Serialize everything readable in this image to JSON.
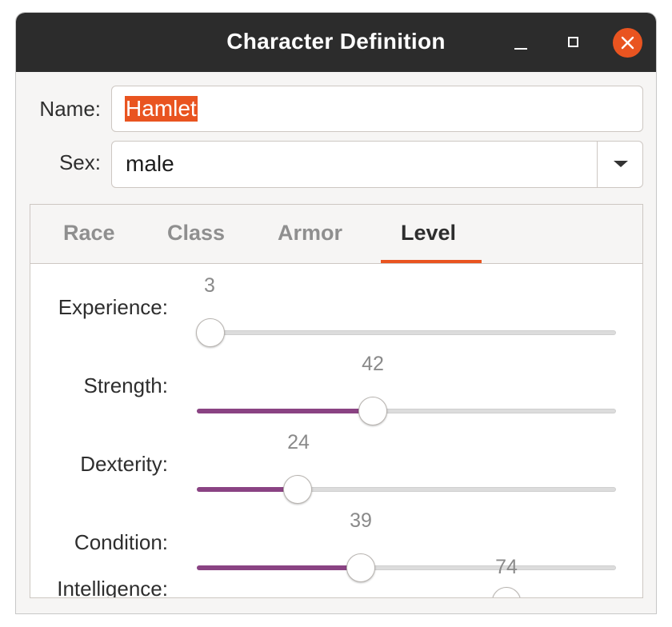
{
  "window": {
    "title": "Character Definition"
  },
  "form": {
    "name_label": "Name:",
    "name_value": "Hamlet",
    "sex_label": "Sex:",
    "sex_value": "male"
  },
  "tabs": [
    {
      "label": "Race",
      "active": false
    },
    {
      "label": "Class",
      "active": false
    },
    {
      "label": "Armor",
      "active": false
    },
    {
      "label": "Level",
      "active": true
    }
  ],
  "sliders": [
    {
      "label": "Experience:",
      "value": "3"
    },
    {
      "label": "Strength:",
      "value": "42"
    },
    {
      "label": "Dexterity:",
      "value": "24"
    },
    {
      "label": "Condition:",
      "value": "39"
    },
    {
      "label": "Intelligence:",
      "value": "74"
    }
  ],
  "colors": {
    "accent": "#e95420",
    "slider_fill": "#8a4383",
    "titlebar": "#2c2c2c"
  },
  "icons": {
    "minimize": "minimize-icon",
    "maximize": "maximize-icon",
    "close": "close-icon",
    "dropdown": "chevron-down-icon"
  }
}
